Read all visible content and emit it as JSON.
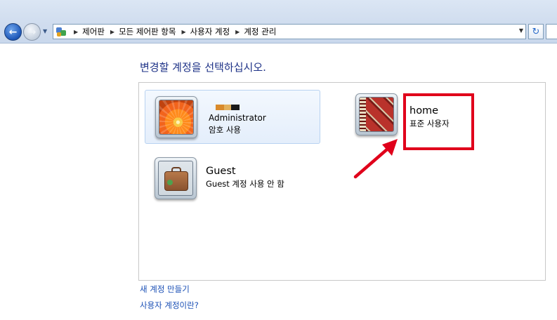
{
  "address_bar": {
    "breadcrumbs": [
      "제어판",
      "모든 제어판 항목",
      "사용자 계정",
      "계정 관리"
    ]
  },
  "main": {
    "title": "변경할 계정을 선택하십시오.",
    "accounts": [
      {
        "name": "Administrator",
        "status": "암호 사용",
        "picture": "orange-flower"
      },
      {
        "name": "home",
        "status": "표준 사용자",
        "picture": "red-rug"
      },
      {
        "name": "Guest",
        "status": "Guest 계정 사용 안 함",
        "picture": "suitcase"
      }
    ],
    "redaction_colors": [
      "#d98a2b",
      "#e3b15c",
      "#1a1a1a"
    ]
  },
  "links": {
    "create_account": "새 계정 만들기",
    "what_is_account": "사용자 계정이란?"
  },
  "annotation": {
    "color": "#e0001b"
  }
}
